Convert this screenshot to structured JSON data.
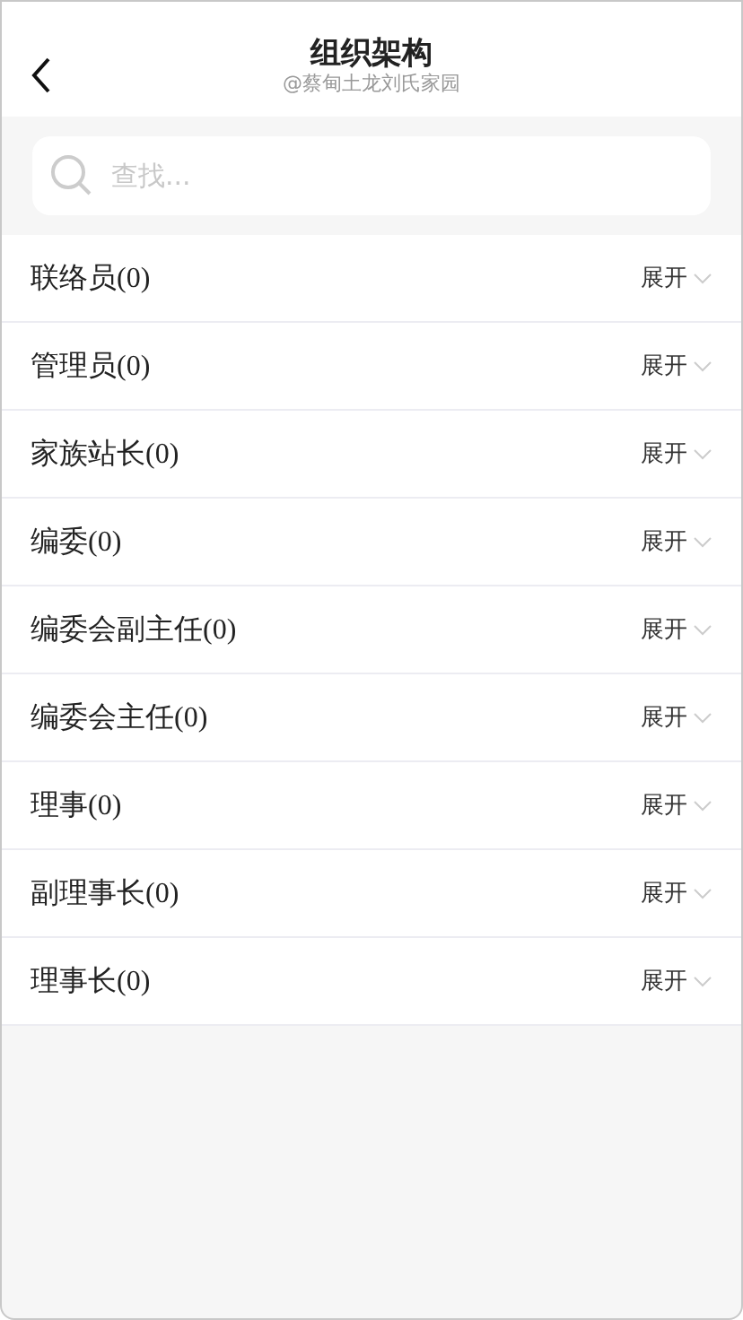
{
  "header": {
    "title": "组织架构",
    "subtitle": "@蔡甸土龙刘氏家园"
  },
  "search": {
    "placeholder": "查找..."
  },
  "groups": [
    {
      "label": "联络员(0)",
      "toggle": "展开",
      "expanded": false
    },
    {
      "label": "管理员(0)",
      "toggle": "展开",
      "expanded": false
    },
    {
      "label": "家族站长(0)",
      "toggle": "展开",
      "expanded": false
    },
    {
      "label": "编委(0)",
      "toggle": "展开",
      "expanded": false
    },
    {
      "label": "编委会副主任(0)",
      "toggle": "展开",
      "expanded": false
    },
    {
      "label": "编委会主任(0)",
      "toggle": "展开",
      "expanded": false
    },
    {
      "label": "理事(0)",
      "toggle": "展开",
      "expanded": false
    },
    {
      "label": "副理事长(0)",
      "toggle": "展开",
      "expanded": false
    },
    {
      "label": "理事长(0)",
      "toggle": "展开",
      "expanded": false
    }
  ]
}
